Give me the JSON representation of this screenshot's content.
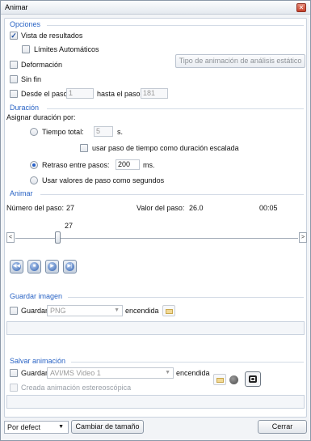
{
  "window": {
    "title": "Animar",
    "close_glyph": "✕"
  },
  "options": {
    "section_title": "Opciones",
    "vista_resultados": {
      "label": "Vista de resultados",
      "checked": true
    },
    "limites_automaticos": {
      "label": "Límites Automáticos",
      "checked": false
    },
    "tipo_animacion_button": "Tipo de animación de análisis estático",
    "deformacion": {
      "label": "Deformación",
      "checked": false
    },
    "sin_fin": {
      "label": "Sin fin",
      "checked": false
    },
    "desde_paso": {
      "label": "Desde el paso",
      "value": "1"
    },
    "hasta_paso": {
      "label": "hasta el paso",
      "value": "181"
    }
  },
  "duration": {
    "section_title": "Duración",
    "assign_label": "Asignar duración por:",
    "tiempo_total": {
      "label": "Tiempo total:",
      "value": "5",
      "unit": "s.",
      "selected": false
    },
    "usar_paso_tiempo": {
      "label": "usar paso de tiempo como duración escalada",
      "checked": false
    },
    "retraso": {
      "label": "Retraso entre pasos:",
      "value": "200",
      "unit": "ms.",
      "selected": true
    },
    "usar_valores": {
      "label": "Usar valores de paso como segundos",
      "selected": false
    }
  },
  "animate": {
    "section_title": "Animar",
    "numero_paso_label": "Número del paso:",
    "numero_paso_value": "27",
    "valor_paso_label": "Valor del paso:",
    "valor_paso_value": "26.0",
    "time": "00:05",
    "slider_value": "27",
    "slider_fraction": 0.144,
    "scroll_left": "<",
    "scroll_right": ">",
    "media_glyphs": {
      "rewind": "◀◀",
      "stop": "■",
      "play": "▶",
      "step": "▶|"
    }
  },
  "save_image": {
    "section_title": "Guardar imagen",
    "guardar_label": "Guardar",
    "format": "PNG",
    "encendida_label": "encendida",
    "combo_arrow": "▼"
  },
  "save_animation": {
    "section_title": "Salvar animación",
    "guardar_label": "Guardar",
    "format": "AVI/MS Video 1",
    "encendida_label": "encendida",
    "stereo_label": "Creada animación estereoscópica",
    "combo_arrow": "▼"
  },
  "footer": {
    "preset": "Por defect",
    "preset_arrow": "▼",
    "resize_button": "Cambiar de tamaño",
    "close_button": "Cerrar"
  }
}
